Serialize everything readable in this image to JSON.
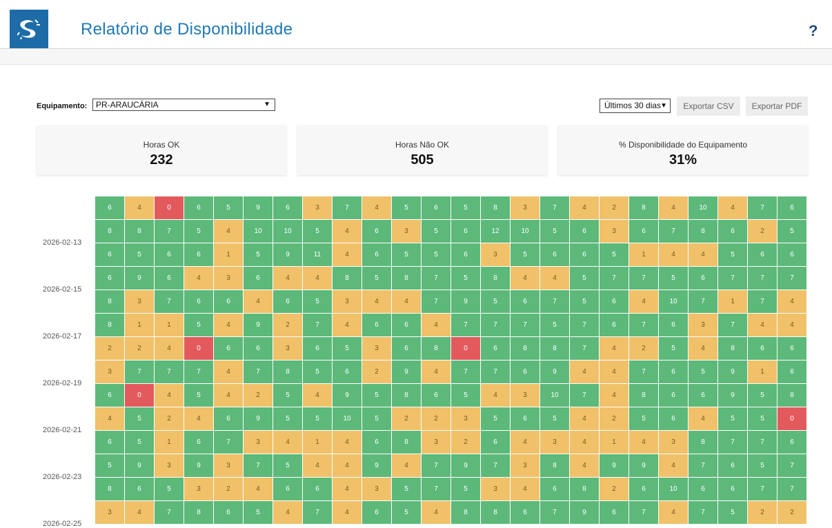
{
  "header": {
    "title": "Relatório de Disponibilidade",
    "help": "?"
  },
  "filters": {
    "equipment_label": "Equipamento:",
    "equipment_value": "PR-ARAUCÁRIA",
    "range_value": "Últimos 30 dias",
    "export_csv": "Exportar CSV",
    "export_pdf": "Exportar PDF"
  },
  "stats": [
    {
      "label": "Horas OK",
      "value": "232"
    },
    {
      "label": "Horas Não OK",
      "value": "505"
    },
    {
      "label": "% Disponibilidade do Equipamento",
      "value": "31%"
    }
  ],
  "colors": {
    "ok": "#5cb97a",
    "warn": "#f0c169",
    "bad": "#e35a5d",
    "brand": "#1d6ca8"
  },
  "heatmap": {
    "row_labels": [
      "2026-02-13",
      "2026-02-15",
      "2026-02-17",
      "2026-02-19",
      "2026-02-21",
      "2026-02-23",
      "2026-02-25"
    ],
    "rows": [
      [
        6,
        4,
        0,
        6,
        5,
        9,
        6,
        3,
        7,
        4,
        5,
        6,
        5,
        8,
        3,
        7,
        4,
        2,
        8,
        4,
        10,
        4,
        7,
        6
      ],
      [
        8,
        8,
        7,
        5,
        4,
        10,
        10,
        5,
        4,
        6,
        3,
        5,
        6,
        12,
        10,
        5,
        6,
        3,
        6,
        7,
        8,
        6,
        2,
        5
      ],
      [
        6,
        5,
        6,
        6,
        1,
        5,
        9,
        11,
        4,
        6,
        5,
        5,
        6,
        3,
        5,
        6,
        6,
        5,
        1,
        4,
        4,
        5,
        6,
        6
      ],
      [
        6,
        9,
        6,
        4,
        3,
        6,
        4,
        4,
        8,
        5,
        8,
        7,
        5,
        8,
        4,
        4,
        5,
        7,
        7,
        5,
        6,
        7,
        7,
        7
      ],
      [
        8,
        3,
        7,
        6,
        6,
        4,
        6,
        5,
        3,
        4,
        4,
        7,
        9,
        5,
        6,
        7,
        5,
        6,
        4,
        10,
        7,
        1,
        7,
        4
      ],
      [
        8,
        1,
        1,
        5,
        4,
        9,
        2,
        7,
        4,
        6,
        6,
        4,
        7,
        7,
        7,
        5,
        7,
        6,
        7,
        6,
        3,
        7,
        4,
        4
      ],
      [
        2,
        2,
        4,
        0,
        6,
        6,
        3,
        6,
        5,
        3,
        6,
        8,
        0,
        6,
        8,
        8,
        7,
        4,
        2,
        5,
        4,
        8,
        6,
        6
      ],
      [
        3,
        7,
        7,
        7,
        4,
        7,
        8,
        5,
        6,
        2,
        9,
        4,
        7,
        7,
        6,
        9,
        4,
        4,
        7,
        6,
        5,
        9,
        1,
        6
      ],
      [
        6,
        0,
        4,
        5,
        4,
        2,
        5,
        4,
        9,
        5,
        8,
        6,
        5,
        4,
        3,
        10,
        7,
        4,
        8,
        6,
        6,
        9,
        5,
        8
      ],
      [
        4,
        5,
        2,
        4,
        6,
        9,
        5,
        5,
        10,
        5,
        2,
        2,
        3,
        5,
        6,
        5,
        4,
        2,
        5,
        6,
        4,
        5,
        5,
        0
      ],
      [
        6,
        5,
        1,
        6,
        7,
        3,
        4,
        1,
        4,
        6,
        8,
        3,
        2,
        6,
        4,
        3,
        4,
        1,
        4,
        3,
        8,
        7,
        7,
        6
      ],
      [
        5,
        9,
        3,
        9,
        3,
        7,
        5,
        4,
        4,
        9,
        4,
        7,
        9,
        7,
        3,
        8,
        4,
        9,
        9,
        4,
        7,
        6,
        5,
        7
      ],
      [
        8,
        6,
        5,
        3,
        2,
        4,
        6,
        6,
        4,
        3,
        5,
        7,
        5,
        3,
        4,
        6,
        8,
        2,
        6,
        10,
        6,
        6,
        7,
        7
      ],
      [
        3,
        4,
        7,
        8,
        6,
        5,
        4,
        7,
        4,
        6,
        5,
        4,
        8,
        8,
        6,
        7,
        9,
        6,
        7,
        4,
        7,
        5,
        2,
        2
      ]
    ]
  }
}
